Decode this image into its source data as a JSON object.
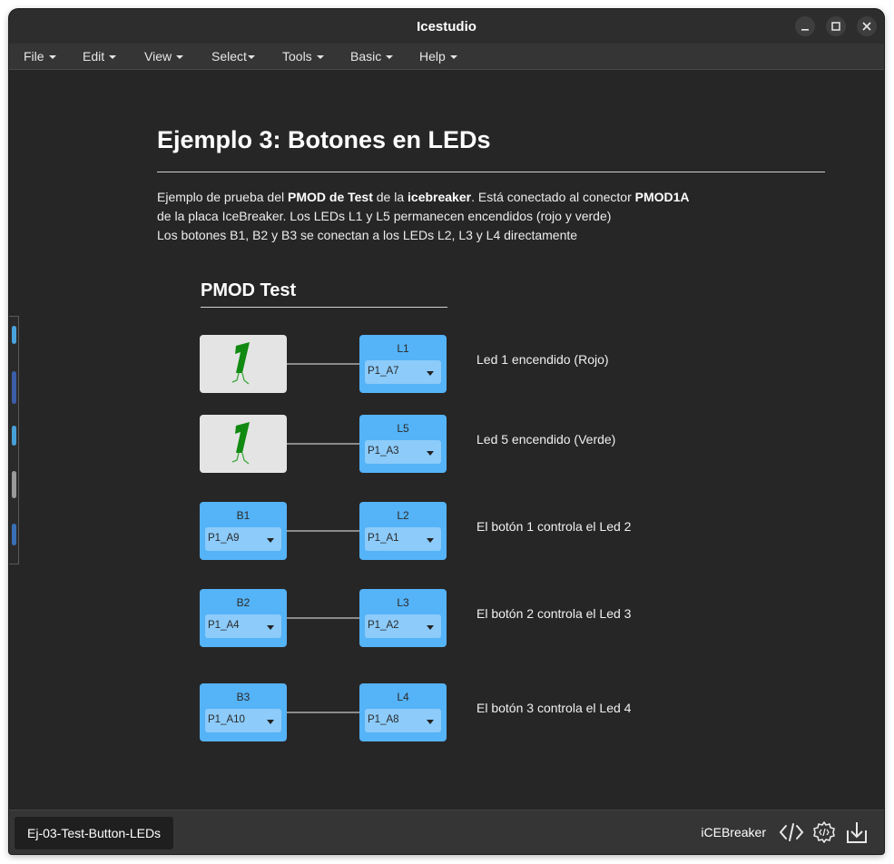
{
  "window": {
    "title": "Icestudio"
  },
  "menu": [
    {
      "label": "File"
    },
    {
      "label": "Edit"
    },
    {
      "label": "View"
    },
    {
      "label": "Select"
    },
    {
      "label": "Tools"
    },
    {
      "label": "Basic"
    },
    {
      "label": "Help"
    }
  ],
  "canvas": {
    "heading": "Ejemplo 3: Botones en LEDs",
    "description": {
      "l1a": "Ejemplo de prueba del ",
      "l1b": "PMOD de Test",
      "l1c": " de la ",
      "l1d": "icebreaker",
      "l1e": ". Está conectado al conector ",
      "l1f": "PMOD1A",
      "l2": "de la placa IceBreaker. Los LEDs L1 y L5 permanecen encendidos (rojo y verde)",
      "l3": "Los botones B1, B2 y B3 se conectan a los LEDs L2, L3 y L4 directamente"
    },
    "subheading": "PMOD Test",
    "rows": [
      {
        "input": {
          "kind": "constant-1"
        },
        "output": {
          "name": "L1",
          "pin": "P1_A7"
        },
        "comment": "Led 1 encendido (Rojo)"
      },
      {
        "input": {
          "kind": "constant-1"
        },
        "output": {
          "name": "L5",
          "pin": "P1_A3"
        },
        "comment": "Led 5 encendido (Verde)"
      },
      {
        "input": {
          "name": "B1",
          "pin": "P1_A9"
        },
        "output": {
          "name": "L2",
          "pin": "P1_A1"
        },
        "comment": "El botón 1 controla el Led 2"
      },
      {
        "input": {
          "name": "B2",
          "pin": "P1_A4"
        },
        "output": {
          "name": "L3",
          "pin": "P1_A2"
        },
        "comment": "El botón 2 controla el Led 3"
      },
      {
        "input": {
          "name": "B3",
          "pin": "P1_A10"
        },
        "output": {
          "name": "L4",
          "pin": "P1_A8"
        },
        "comment": "El botón 3 controla el Led 4"
      }
    ]
  },
  "status": {
    "file_tab": "Ej-03-Test-Button-LEDs",
    "board": "iCEBreaker",
    "icons": [
      "code-icon",
      "verify-gear-icon",
      "upload-icon"
    ]
  },
  "colors": {
    "background": "#262626",
    "block_blue": "#55b3f7",
    "pin_field": "#8ccbfa",
    "constant_bg": "#e4e4e4",
    "constant_green": "#118a11"
  }
}
